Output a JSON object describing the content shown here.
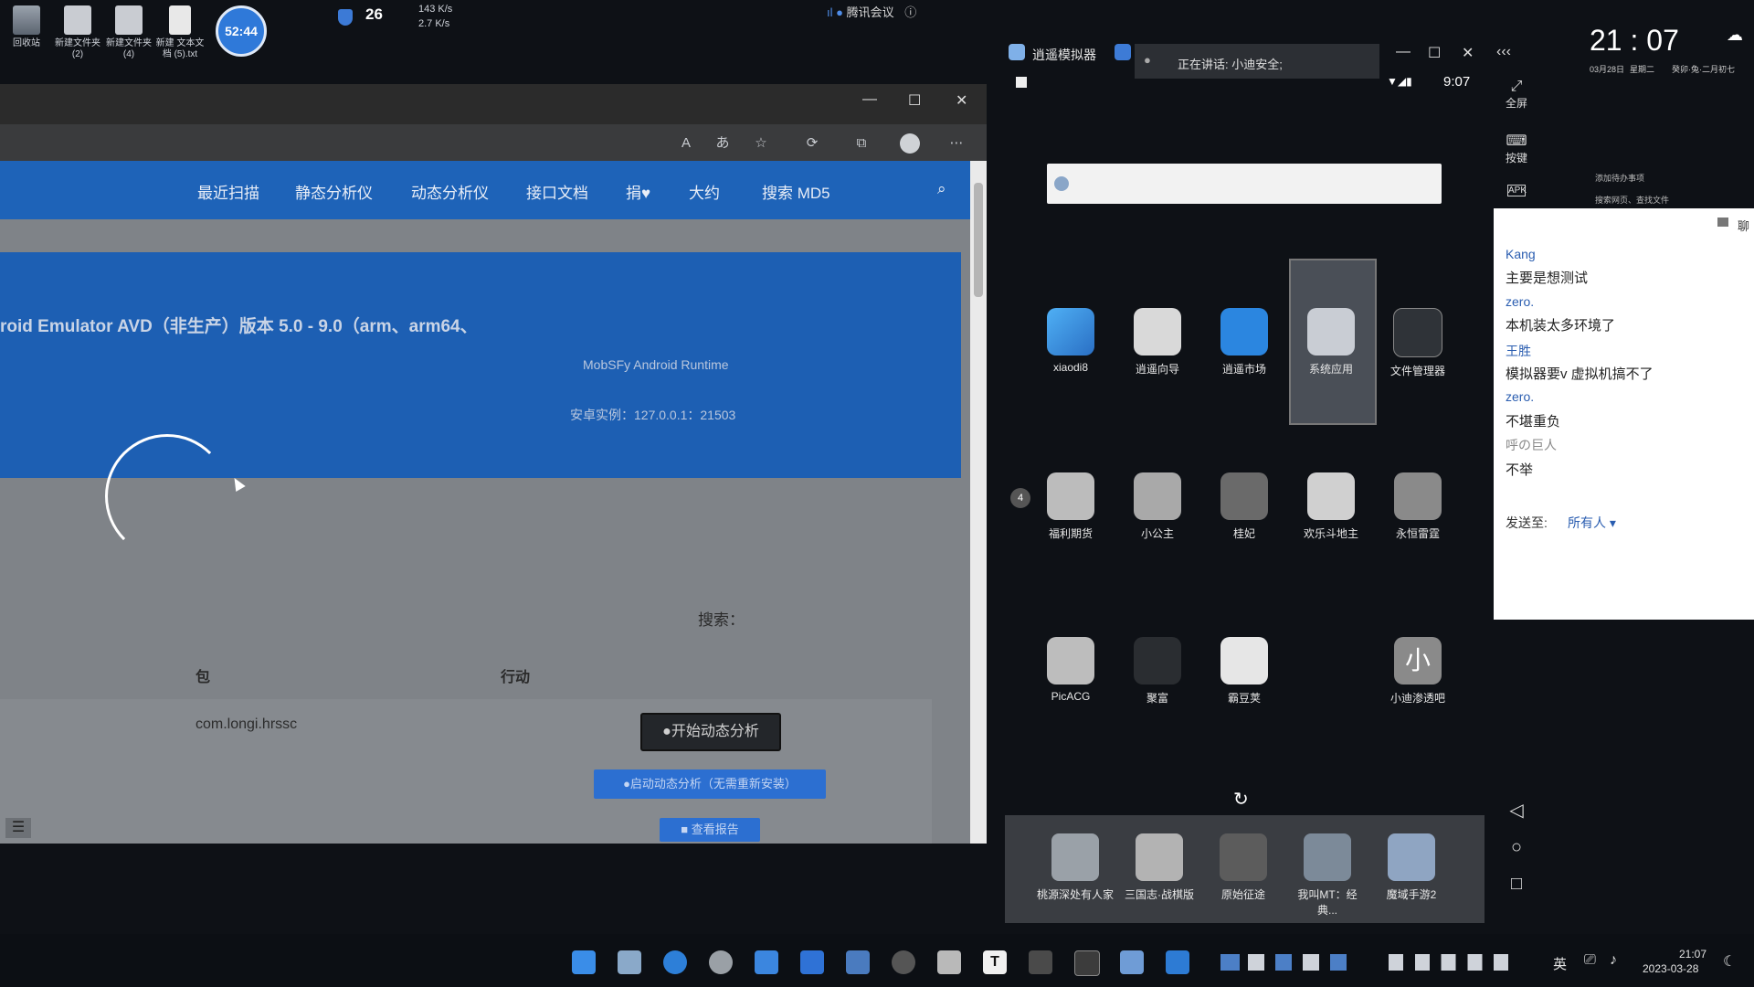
{
  "desktop": {
    "icons": [
      {
        "label": "回收站"
      },
      {
        "label": "新建文件夹 (2)"
      },
      {
        "label": "新建文件夹 (4)"
      },
      {
        "label": "新建 文本文档 (5).txt"
      }
    ],
    "timer": "52:44",
    "temperature": "26",
    "net_up": "143 K/s",
    "net_down": "2.7 K/s",
    "meeting_app": "腾讯会议"
  },
  "browser": {
    "nav": {
      "items": [
        "最近扫描",
        "静态分析仪",
        "动态分析仪",
        "接口文档",
        "捐♥",
        "大约",
        "搜索 MD5"
      ]
    },
    "banner": {
      "title": "roid Emulator AVD（非生产）版本 5.0 - 9.0（arm、arm64、",
      "runtime": "MobSFy Android Runtime",
      "instance": "安卓实例：127.0.0.1：21503"
    },
    "search_label": "搜索：",
    "table": {
      "headers": [
        "包",
        "行动"
      ],
      "rows": [
        {
          "package": "com.longi.hrssc",
          "action_primary": "●开始动态分析",
          "action_secondary": "●启动动态分析（无需重新安装）",
          "action_tertiary": "■ 查看报告"
        }
      ]
    }
  },
  "emulator": {
    "title": "逍遥模拟器",
    "speaking": "正在讲话: 小迪安全;",
    "time": "9:07",
    "search_placeholder": "",
    "apps_row1": [
      "xiaodi8",
      "逍遥向导",
      "逍遥市场",
      "系统应用",
      "文件管理器"
    ],
    "apps_row2": [
      "福利期货",
      "小公主",
      "桂妃",
      "欢乐斗地主",
      "永恒雷霆"
    ],
    "apps_row3": [
      "PicACG",
      "聚富",
      "霸豆荚",
      "小迪渗透吧"
    ],
    "dock": [
      "桃源深处有人家",
      "三国志·战棋版",
      "原始征途",
      "我叫MT：经典...",
      "魔域手游2"
    ],
    "side": {
      "fullscreen": "全屏",
      "keys": "按键",
      "apk": "APK"
    }
  },
  "clock_widget": {
    "time": "21 : 07",
    "date": "03月28日",
    "weekday": "星期二",
    "lunar": "癸卯·兔·二月初七",
    "todo": "添加待办事项",
    "search_hint": "搜索网页、查找文件"
  },
  "chat": {
    "header": "聊",
    "messages": [
      {
        "name": "Kang",
        "text": "主要是想测试",
        "color": "#2a5db0"
      },
      {
        "name": "zero.",
        "text": "本机装太多环境了",
        "color": "#2a5db0"
      },
      {
        "name": "王胜",
        "text": "模拟器要v  虚拟机搞不了",
        "color": "#2a5db0"
      },
      {
        "name": "zero.",
        "text": "不堪重负",
        "color": "#2a5db0"
      },
      {
        "name": "呼の巨人",
        "text": "不举",
        "color": "#888888"
      }
    ],
    "send_to_label": "发送至:",
    "send_to_value": "所有人 ▾"
  },
  "taskbar": {
    "ime": "英",
    "time": "21:07",
    "date": "2023-03-28"
  }
}
